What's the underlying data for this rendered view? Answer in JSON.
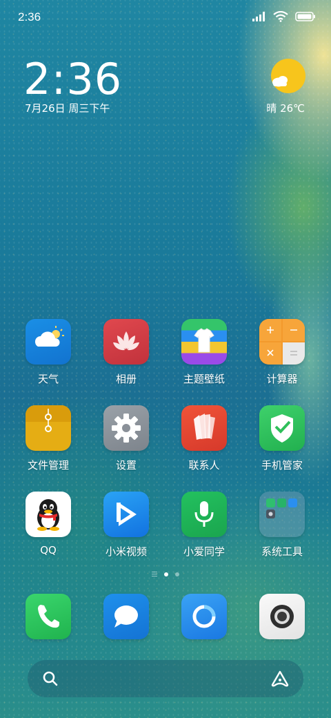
{
  "status_bar": {
    "time": "2:36"
  },
  "clock_widget": {
    "time": "2:36",
    "date": "7月26日 周三下午"
  },
  "weather_widget": {
    "text": "晴 26℃",
    "icon": "sunny-cloud-icon"
  },
  "apps": [
    {
      "label": "天气",
      "icon": "weather-icon"
    },
    {
      "label": "相册",
      "icon": "gallery-icon"
    },
    {
      "label": "主题壁纸",
      "icon": "themes-icon"
    },
    {
      "label": "计算器",
      "icon": "calculator-icon"
    },
    {
      "label": "文件管理",
      "icon": "file-manager-icon"
    },
    {
      "label": "设置",
      "icon": "settings-icon"
    },
    {
      "label": "联系人",
      "icon": "contacts-icon"
    },
    {
      "label": "手机管家",
      "icon": "security-icon"
    },
    {
      "label": "QQ",
      "icon": "qq-icon"
    },
    {
      "label": "小米视频",
      "icon": "video-icon"
    },
    {
      "label": "小爱同学",
      "icon": "voice-assistant-icon"
    },
    {
      "label": "系统工具",
      "icon": "folder-icon"
    }
  ],
  "dock": [
    {
      "icon": "phone-icon"
    },
    {
      "icon": "messages-icon"
    },
    {
      "icon": "browser-icon"
    },
    {
      "icon": "camera-icon"
    }
  ],
  "pager": {
    "pages": 2,
    "current": 1
  },
  "colors": {
    "accent_blue": "#1a85e0",
    "accent_green": "#25c24a"
  }
}
